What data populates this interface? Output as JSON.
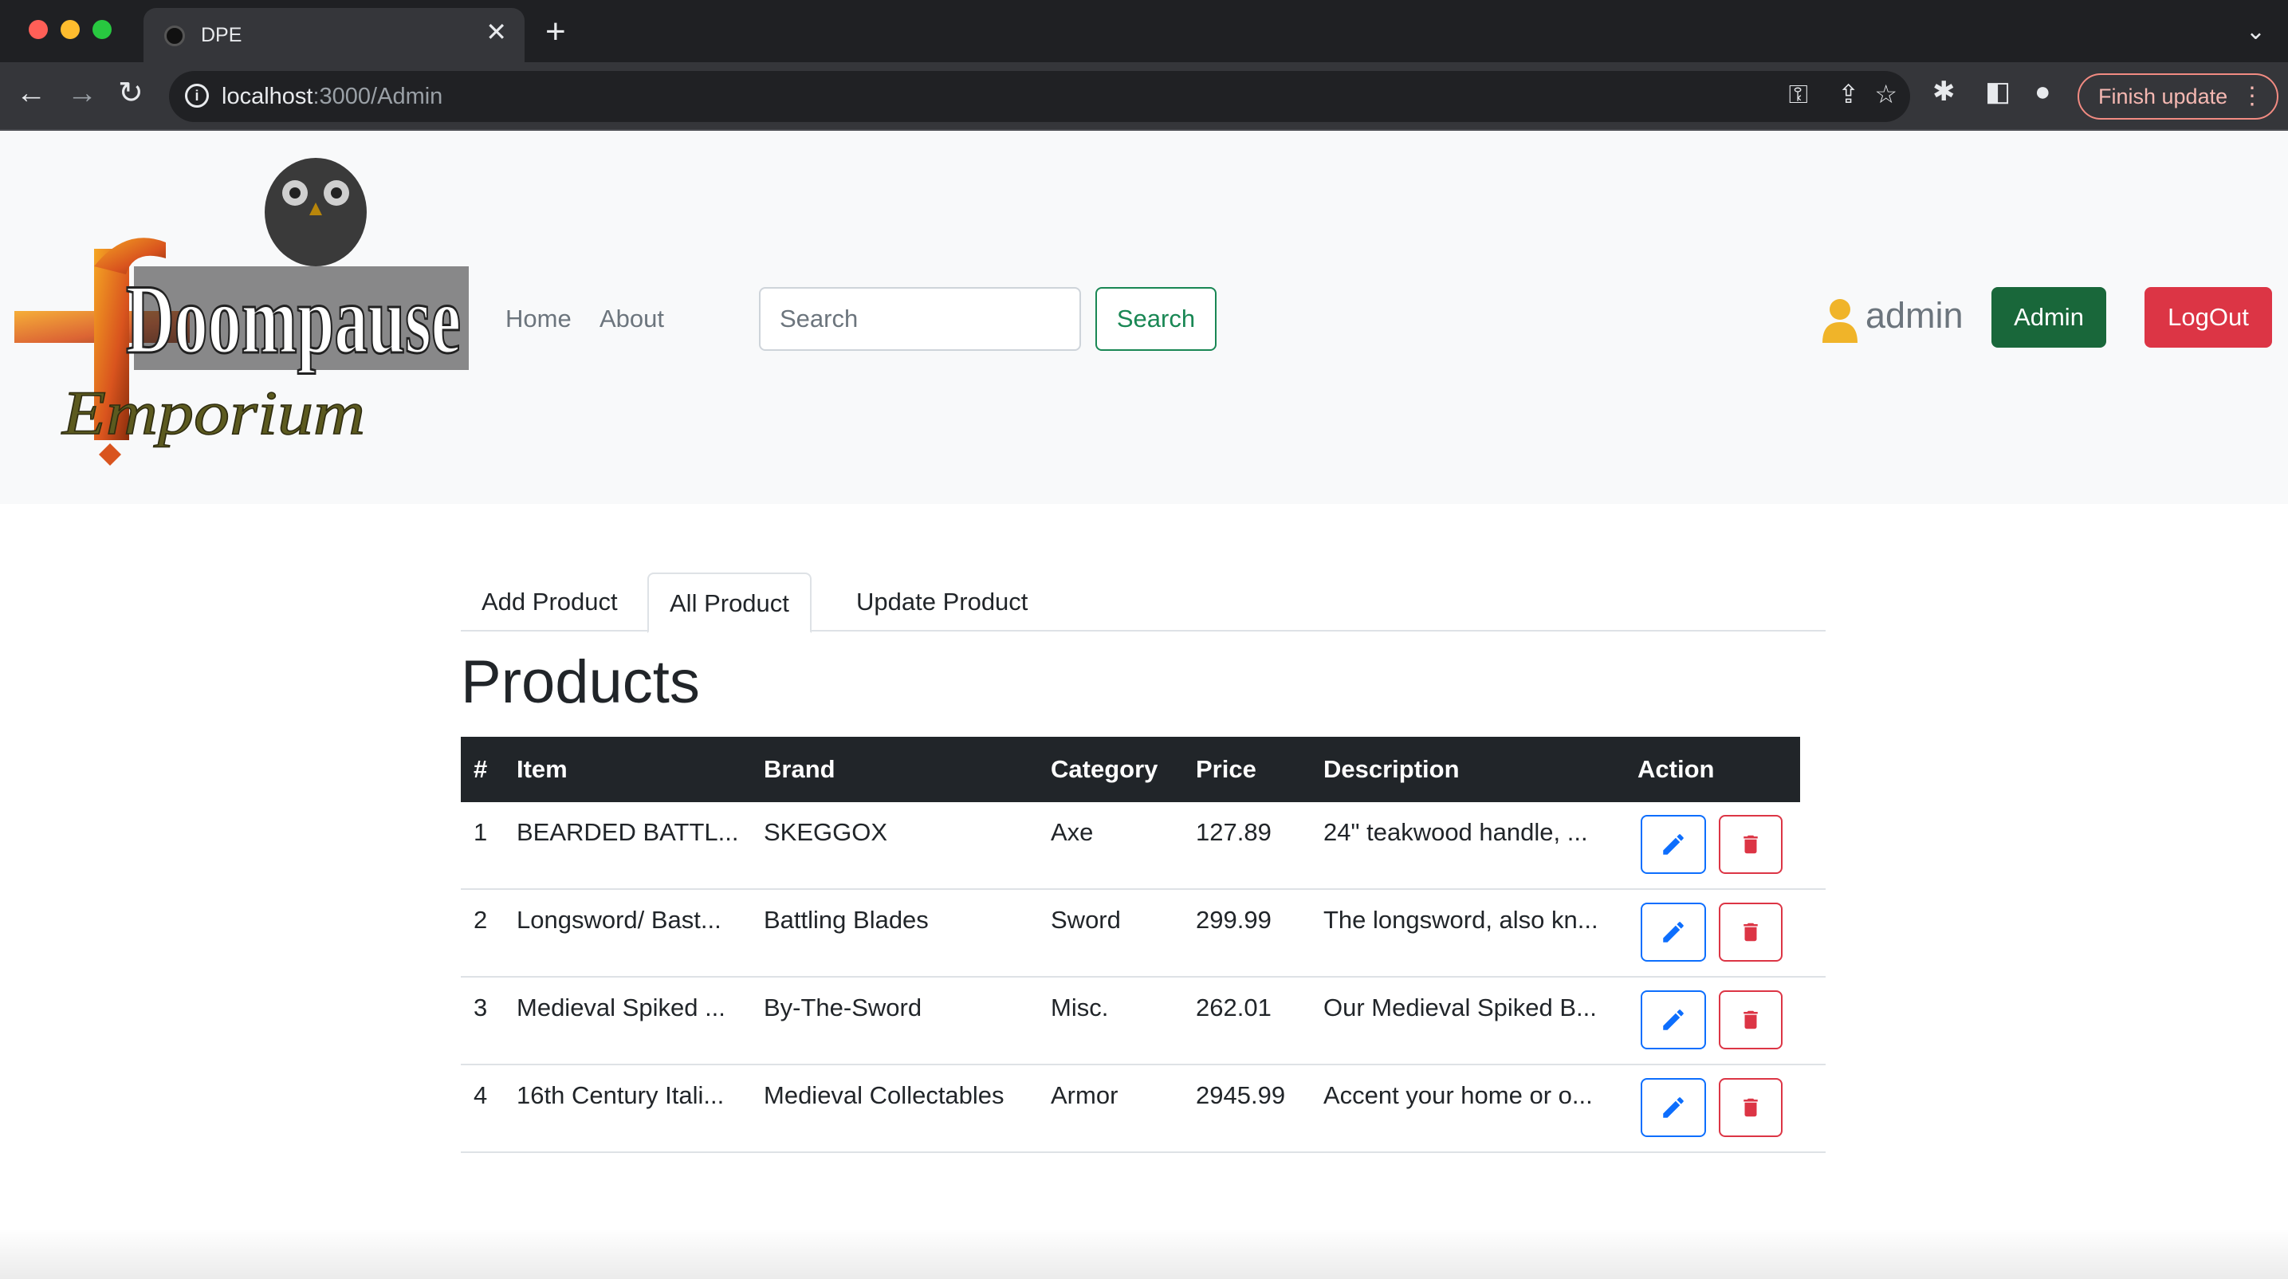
{
  "browser": {
    "tab_title": "DPE",
    "url_host": "localhost",
    "url_path": ":3000/Admin",
    "finish_update": "Finish update"
  },
  "navbar": {
    "logo_line1": "Doompause",
    "logo_line2": "Emporium",
    "links": {
      "home": "Home",
      "about": "About"
    },
    "search": {
      "placeholder": "Search",
      "button": "Search"
    },
    "user": "admin",
    "admin_button": "Admin",
    "logout_button": "LogOut"
  },
  "tabs": {
    "add": "Add Product",
    "all": "All Product",
    "update": "Update Product"
  },
  "page_title": "Products",
  "table": {
    "headers": {
      "num": "#",
      "item": "Item",
      "brand": "Brand",
      "category": "Category",
      "price": "Price",
      "description": "Description",
      "action": "Action"
    },
    "rows": [
      {
        "num": "1",
        "item": "BEARDED BATTL...",
        "brand": "SKEGGOX",
        "category": "Axe",
        "price": "127.89",
        "description": "24\" teakwood handle, ..."
      },
      {
        "num": "2",
        "item": "Longsword/ Bast...",
        "brand": "Battling Blades",
        "category": "Sword",
        "price": "299.99",
        "description": "The longsword, also kn..."
      },
      {
        "num": "3",
        "item": "Medieval Spiked ...",
        "brand": "By-The-Sword",
        "category": "Misc.",
        "price": "262.01",
        "description": "Our Medieval Spiked B..."
      },
      {
        "num": "4",
        "item": "16th Century Itali...",
        "brand": "Medieval Collectables",
        "category": "Armor",
        "price": "2945.99",
        "description": "Accent your home or o..."
      }
    ]
  },
  "colors": {
    "success": "#198754",
    "danger": "#dc3545",
    "primary": "#0d6efd",
    "dark": "#212529",
    "user_icon": "#f0b429"
  }
}
